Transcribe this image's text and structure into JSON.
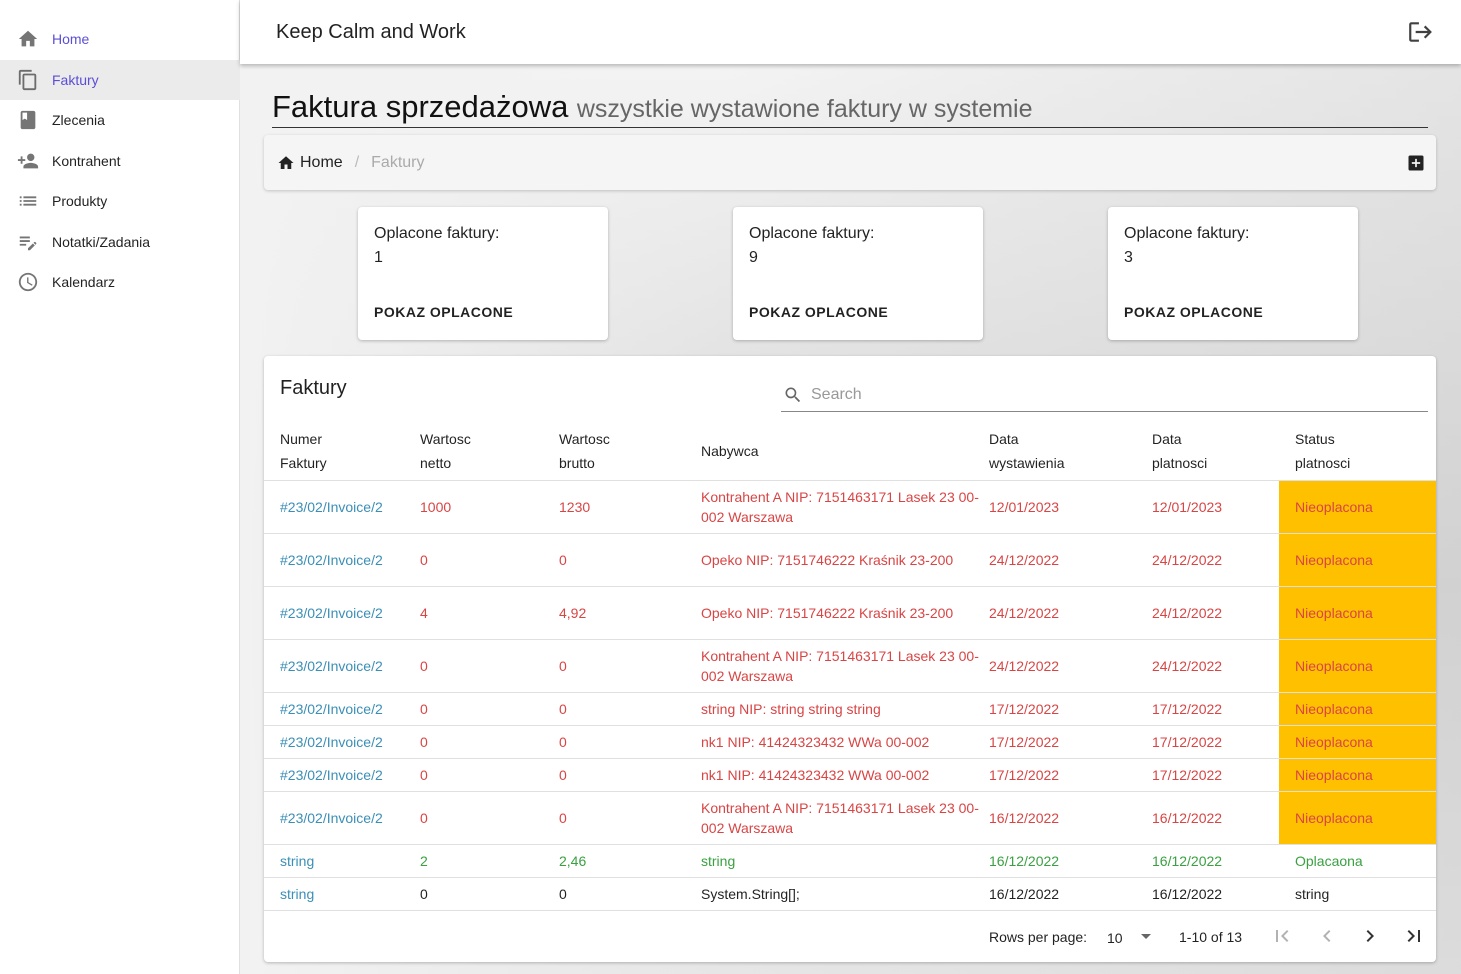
{
  "sidebar": {
    "items": [
      {
        "label": "Home",
        "icon": "home-icon",
        "active": true
      },
      {
        "label": "Faktury",
        "icon": "copy-icon",
        "active": true
      },
      {
        "label": "Zlecenia",
        "icon": "book-icon"
      },
      {
        "label": "Kontrahent",
        "icon": "person-add-icon"
      },
      {
        "label": "Produkty",
        "icon": "list-icon"
      },
      {
        "label": "Notatki/Zadania",
        "icon": "edit-note-icon"
      },
      {
        "label": "Kalendarz",
        "icon": "clock-icon"
      }
    ]
  },
  "appbar": {
    "title": "Keep Calm and Work",
    "logout_icon": "logout-icon"
  },
  "page": {
    "title": "Faktura sprzedażowa",
    "subtitle": "wszystkie wystawione faktury w systemie"
  },
  "breadcrumb": {
    "home": "Home",
    "separator": "/",
    "current": "Faktury",
    "add_icon": "add-box-icon"
  },
  "stats": [
    {
      "label": "Oplacone faktury:",
      "value": "1",
      "button": "POKAZ OPLACONE"
    },
    {
      "label": "Oplacone faktury:",
      "value": "9",
      "button": "POKAZ OPLACONE"
    },
    {
      "label": "Oplacone faktury:",
      "value": "3",
      "button": "POKAZ OPLACONE"
    }
  ],
  "table": {
    "title": "Faktury",
    "search_placeholder": "Search",
    "headers": [
      {
        "line1": "Numer",
        "line2": "Faktury"
      },
      {
        "line1": "Wartosc",
        "line2": "netto"
      },
      {
        "line1": "Wartosc",
        "line2": "brutto"
      },
      {
        "line1": "Nabywca",
        "line2": ""
      },
      {
        "line1": "Data",
        "line2": "wystawienia"
      },
      {
        "line1": "Data",
        "line2": "platnosci"
      },
      {
        "line1": "Status",
        "line2": "platnosci"
      }
    ],
    "rows": [
      {
        "numer": "#23/02/Invoice/2",
        "netto": "1000",
        "brutto": "1230",
        "nabywca": "Kontrahent A NIP: 7151463171 Lasek 23 00-002 Warszawa",
        "wystawienia": "12/01/2023",
        "platnosci": "12/01/2023",
        "status": "Nieoplacona"
      },
      {
        "numer": "#23/02/Invoice/2",
        "netto": "0",
        "brutto": "0",
        "nabywca": "Opeko NIP: 7151746222 Kraśnik 23-200",
        "wystawienia": "24/12/2022",
        "platnosci": "24/12/2022",
        "status": "Nieoplacona"
      },
      {
        "numer": "#23/02/Invoice/2",
        "netto": "4",
        "brutto": "4,92",
        "nabywca": "Opeko NIP: 7151746222 Kraśnik 23-200",
        "wystawienia": "24/12/2022",
        "platnosci": "24/12/2022",
        "status": "Nieoplacona"
      },
      {
        "numer": "#23/02/Invoice/2",
        "netto": "0",
        "brutto": "0",
        "nabywca": "Kontrahent A NIP: 7151463171 Lasek 23 00-002 Warszawa",
        "wystawienia": "24/12/2022",
        "platnosci": "24/12/2022",
        "status": "Nieoplacona"
      },
      {
        "numer": "#23/02/Invoice/2",
        "netto": "0",
        "brutto": "0",
        "nabywca": "string NIP: string string string",
        "wystawienia": "17/12/2022",
        "platnosci": "17/12/2022",
        "status": "Nieoplacona"
      },
      {
        "numer": "#23/02/Invoice/2",
        "netto": "0",
        "brutto": "0",
        "nabywca": "nk1 NIP: 41424323432 WWa 00-002",
        "wystawienia": "17/12/2022",
        "platnosci": "17/12/2022",
        "status": "Nieoplacona"
      },
      {
        "numer": "#23/02/Invoice/2",
        "netto": "0",
        "brutto": "0",
        "nabywca": "nk1 NIP: 41424323432 WWa 00-002",
        "wystawienia": "17/12/2022",
        "platnosci": "17/12/2022",
        "status": "Nieoplacona"
      },
      {
        "numer": "#23/02/Invoice/2",
        "netto": "0",
        "brutto": "0",
        "nabywca": "Kontrahent A NIP: 7151463171 Lasek 23 00-002 Warszawa",
        "wystawienia": "16/12/2022",
        "platnosci": "16/12/2022",
        "status": "Nieoplacona"
      },
      {
        "numer": "string",
        "netto": "2",
        "brutto": "2,46",
        "nabywca": "string",
        "wystawienia": "16/12/2022",
        "platnosci": "16/12/2022",
        "status": "Oplacaona"
      },
      {
        "numer": "string",
        "netto": "0",
        "brutto": "0",
        "nabywca": "System.String[];",
        "wystawienia": "16/12/2022",
        "platnosci": "16/12/2022",
        "status": "string"
      }
    ]
  },
  "pager": {
    "rows_label": "Rows per page:",
    "rows_value": "10",
    "range": "1-10 of 13"
  },
  "colors": {
    "accent": "#5b4fd6",
    "link": "#3b8fb6",
    "unpaid_text": "#d84545",
    "unpaid_bg": "#ffc000",
    "paid_text": "#3aa041"
  }
}
